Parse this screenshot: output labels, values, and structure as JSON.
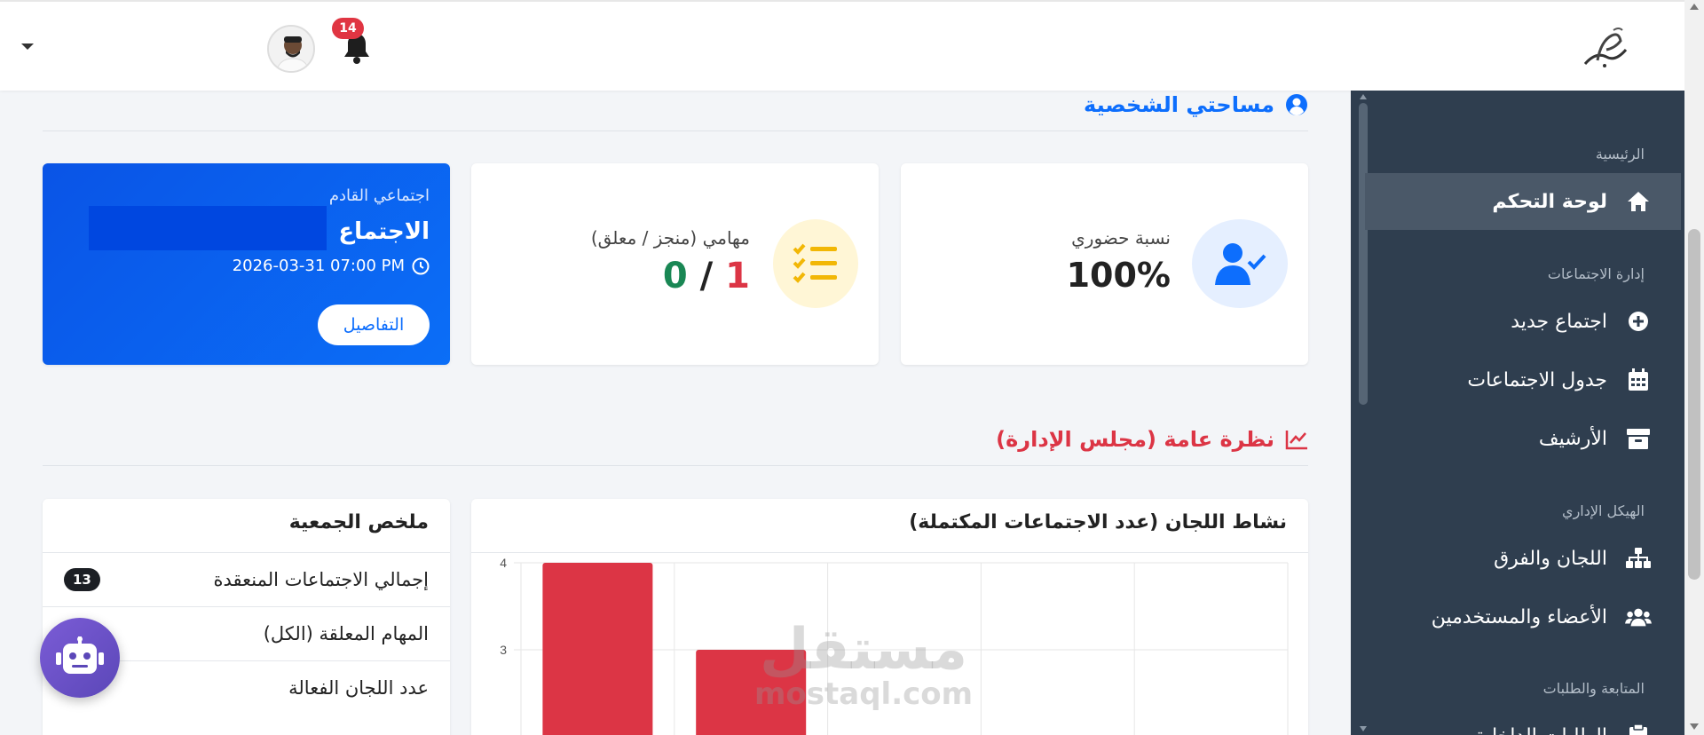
{
  "header": {
    "notifications_count": "14"
  },
  "sidebar": {
    "sections": [
      {
        "label": "الرئيسية"
      },
      {
        "label": "إدارة الاجتماعات"
      },
      {
        "label": "الهيكل الإداري"
      },
      {
        "label": "المتابعة والطلبات"
      }
    ],
    "items": [
      {
        "label": "لوحة التحكم",
        "icon": "home-icon",
        "active": true
      },
      {
        "label": "اجتماع جديد",
        "icon": "plus-circle-icon"
      },
      {
        "label": "جدول الاجتماعات",
        "icon": "calendar-icon"
      },
      {
        "label": "الأرشيف",
        "icon": "archive-icon"
      },
      {
        "label": "اللجان والفرق",
        "icon": "sitemap-icon"
      },
      {
        "label": "الأعضاء والمستخدمين",
        "icon": "users-icon"
      },
      {
        "label": "الطلبات الداخلية",
        "icon": "clipboard-icon"
      }
    ]
  },
  "personal": {
    "title": "مساحتي الشخصية",
    "attendance": {
      "label": "نسبة حضوري",
      "value": "100%"
    },
    "tasks": {
      "label": "مهامي (منجز / معلق)",
      "done": "0",
      "separator": " / ",
      "pending": "1"
    },
    "next_meeting": {
      "label": "اجتماعي القادم",
      "title": "الاجتماع",
      "datetime": "2026-03-31 07:00 PM",
      "details_button": "التفاصيل"
    }
  },
  "overview": {
    "title": "نظرة عامة (مجلس الإدارة)",
    "chart_title": "نشاط اللجان (عدد الاجتماعات المكتملة)",
    "summary_title": "ملخص الجمعية",
    "summary_rows": [
      {
        "label": "إجمالي الاجتماعات المنعقدة",
        "value": "13"
      },
      {
        "label": "المهام المعلقة (الكل)",
        "value": ""
      },
      {
        "label": "عدد اللجان الفعالة",
        "value": ""
      }
    ]
  },
  "chart_data": {
    "type": "bar",
    "categories": [
      "",
      ""
    ],
    "values": [
      4,
      3
    ],
    "title": "نشاط اللجان (عدد الاجتماعات المكتملة)",
    "yticks": [
      "4",
      "3"
    ],
    "ylim_visible": [
      2,
      4.2
    ],
    "color": "#dc3545"
  },
  "watermark": {
    "line1": "مستقل",
    "line2": "mostaql.com"
  },
  "colors": {
    "primary": "#0d6efd",
    "danger": "#dc3545",
    "success": "#198754",
    "sidebar": "#2f3e4f",
    "warning": "#ffc107"
  }
}
